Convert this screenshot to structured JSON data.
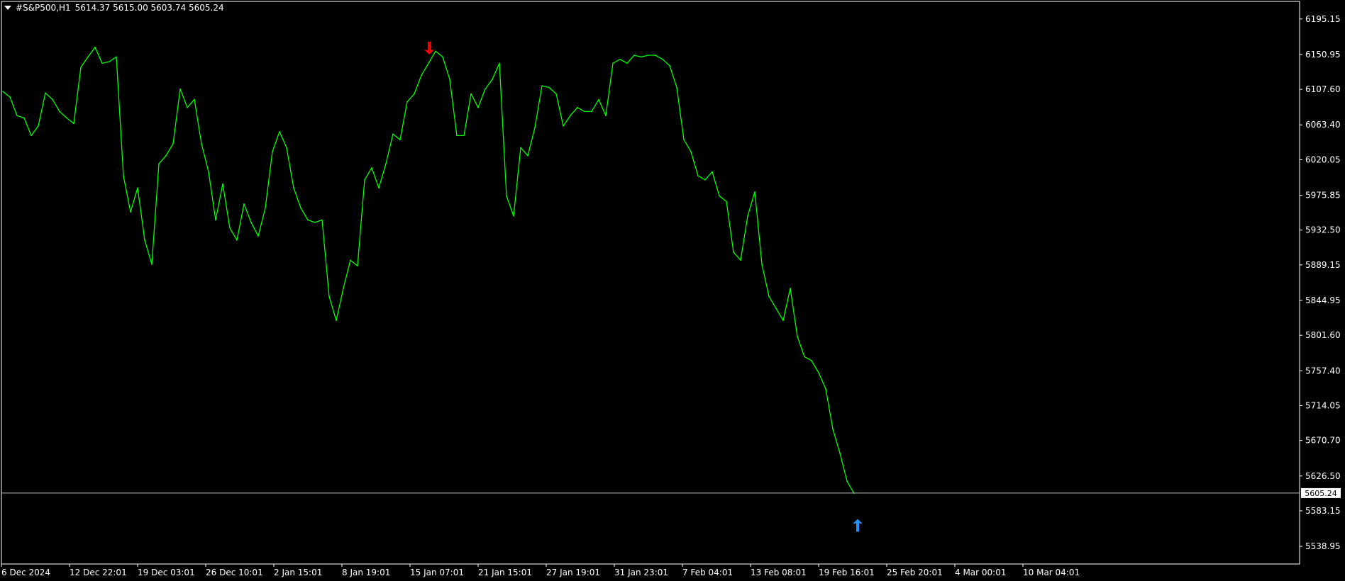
{
  "header": {
    "symbol": "#S&P500,H1",
    "ohlc": "5614.37 5615.00 5603.74 5605.24"
  },
  "colors": {
    "background": "#000000",
    "frame": "#ffffff",
    "series": "#00ff00",
    "sell_arrow": "#ff0000",
    "buy_arrow": "#1e90ff",
    "price_line": "#c0c0c0"
  },
  "chart_data": {
    "type": "line",
    "title": "#S&P500,H1",
    "ylim": [
      5517.0,
      6217.0
    ],
    "yticks": [
      6195.15,
      6150.95,
      6107.6,
      6063.4,
      6020.05,
      5975.85,
      5932.5,
      5889.15,
      5844.95,
      5801.6,
      5757.4,
      5714.05,
      5670.7,
      5626.5,
      5583.15,
      5538.95
    ],
    "xlabels": [
      "6 Dec 2024",
      "12 Dec 22:01",
      "19 Dec 03:01",
      "26 Dec 10:01",
      "2 Jan 15:01",
      "8 Jan 19:01",
      "15 Jan 07:01",
      "21 Jan 15:01",
      "27 Jan 19:01",
      "31 Jan 23:01",
      "7 Feb 04:01",
      "13 Feb 08:01",
      "19 Feb 16:01",
      "25 Feb 20:01",
      "4 Mar 00:01",
      "10 Mar 04:01"
    ],
    "current_price": "5605.24",
    "current_price_value": 5605.24,
    "markers": [
      {
        "type": "sell",
        "bar": 603,
        "price": 6158
      },
      {
        "type": "buy",
        "bar": 1207,
        "price": 5566
      }
    ],
    "series": [
      {
        "bar_start": 2,
        "bar_step": 10,
        "values": [
          6105,
          6098,
          6075,
          6072,
          6050,
          6062,
          6103,
          6095,
          6080,
          6072,
          6065,
          6135,
          6148,
          6160,
          6140,
          6142,
          6148,
          6000,
          5955,
          5985,
          5920,
          5890,
          6015,
          6025,
          6040,
          6108,
          6085,
          6095,
          6040,
          6005,
          5945,
          5990,
          5935,
          5920,
          5965,
          5942,
          5925,
          5960,
          6030,
          6055,
          6035,
          5985,
          5960,
          5945,
          5942,
          5945,
          5850,
          5820,
          5860,
          5895,
          5888,
          5995,
          6010,
          5985,
          6015,
          6052,
          6045,
          6092,
          6102,
          6125,
          6140,
          6155,
          6148,
          6120,
          6050,
          6050,
          6102,
          6085,
          6108,
          6120,
          6140,
          5975,
          5950,
          6035,
          6025,
          6060,
          6112,
          6110,
          6102,
          6062,
          6075,
          6085,
          6080,
          6080,
          6095,
          6075,
          6140,
          6145,
          6140,
          6150,
          6148,
          6150,
          6150,
          6145,
          6137,
          6110,
          6045,
          6030,
          6000,
          5995,
          6005,
          5975,
          5968,
          5905,
          5895,
          5950,
          5980,
          5890,
          5850,
          5835,
          5820,
          5860,
          5800,
          5775,
          5770,
          5755,
          5735,
          5685,
          5655,
          5620,
          5605
        ]
      }
    ]
  }
}
